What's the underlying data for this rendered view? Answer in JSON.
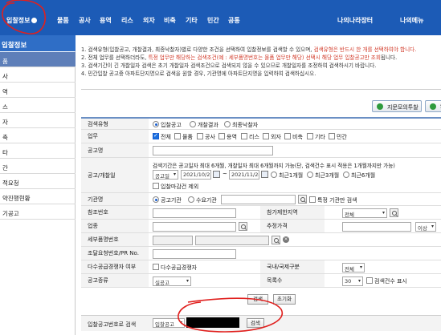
{
  "topnav": {
    "items": [
      "입찰정보",
      "물품",
      "공사",
      "용역",
      "리스",
      "외자",
      "비축",
      "기타",
      "민간",
      "공통"
    ],
    "right_items": [
      "나의나라장터",
      "나의메뉴"
    ]
  },
  "sidebar": {
    "title": "입찰정보",
    "items": [
      "품",
      "사",
      "역",
      "스",
      "자",
      "축",
      "타",
      "간",
      "적요청",
      "약진행현황",
      "기공고"
    ]
  },
  "notice": {
    "line1_a": "1. 검색유형(입찰공고, 개찰결과, 최종낙찰자)별로 다양한 조건을 선택하여 입찰정보를 검색할 수 있으며, ",
    "line1_b": "검색유형은 반드시 한 개를 선택하여야 합니다.",
    "line2_a": "2. 전체 업무를 선택하더라도, ",
    "line2_b": "특정 업무만 해당하는 검색조건(예 : 세부품명번호는 물품 업무만 해당) 선택시 해당 업무 입찰공고만 조회",
    "line2_c": "됩니다.",
    "line3": "3. 검색기간이 긴 개찰일자 검색은 초기 개찰일자 검색조건으로 검색되지 않을 수 있으므로 개찰일자를 조정하여 검색하시기 바랍니다.",
    "line4": "4. 민간입찰 공고중 아파트단지명으로 검색을 원할 경우, 기관명에 아파트단지명을 입력하여 검색하십시오."
  },
  "toolbar": {
    "mock_bid": "지문모의투찰",
    "second": "S"
  },
  "form": {
    "search_type_label": "검색유형",
    "search_types": [
      "입찰공고",
      "개찰결과",
      "최종낙찰자"
    ],
    "business_label": "업무",
    "businesses": [
      "전체",
      "물품",
      "공사",
      "용역",
      "리스",
      "외자",
      "비축",
      "기타",
      "민간"
    ],
    "notice_name_label": "공고명",
    "period_label": "공고/개찰일",
    "period_hint": "검색기간은 공고일자 최대 6개월, 개찰일자 최대 6개월까지 가능(단, 검색건수 표시 적용은 1개월까지만 가능)",
    "date_type": "공고일",
    "date_from": "2021/10/25",
    "date_to": "2021/11/24",
    "tilde": "~",
    "quick_ranges": [
      "최근1개월",
      "최근3개월",
      "최근6개월"
    ],
    "exclude_deadline": "입찰마감건 제외",
    "agency_label": "기관명",
    "agency_types": [
      "공고기관",
      "수요기관"
    ],
    "specific_agency": "특정 기관만 검색",
    "ref_no_label": "참조번호",
    "region_label": "참가제한지역",
    "region_value": "전체",
    "industry_label": "업종",
    "est_price_label": "추정가격",
    "price_cond": "이상",
    "detail_item_label": "세부품명번호",
    "procurement_label": "조달요청번호/PR No.",
    "multi_supply_label": "다수공급경쟁자 여부",
    "multi_supply_option": "다수공급경쟁자",
    "intl_label": "국내/국제구분",
    "intl_value": "전체",
    "notice_type_label": "공고종류",
    "notice_type_value": "실공고",
    "list_count_label": "목록수",
    "list_count_value": "30",
    "show_count": "검색건수 표시",
    "search_btn": "검색",
    "reset_btn": "초기화"
  },
  "bottom": {
    "label": "입찰공고번호로 검색",
    "select_value": "입찰공고",
    "search_btn": "검색"
  },
  "colors": {
    "nav_blue": "#1c5bb6",
    "sidebar_active": "#5e7fb9",
    "annotation_red": "#e0201e"
  }
}
